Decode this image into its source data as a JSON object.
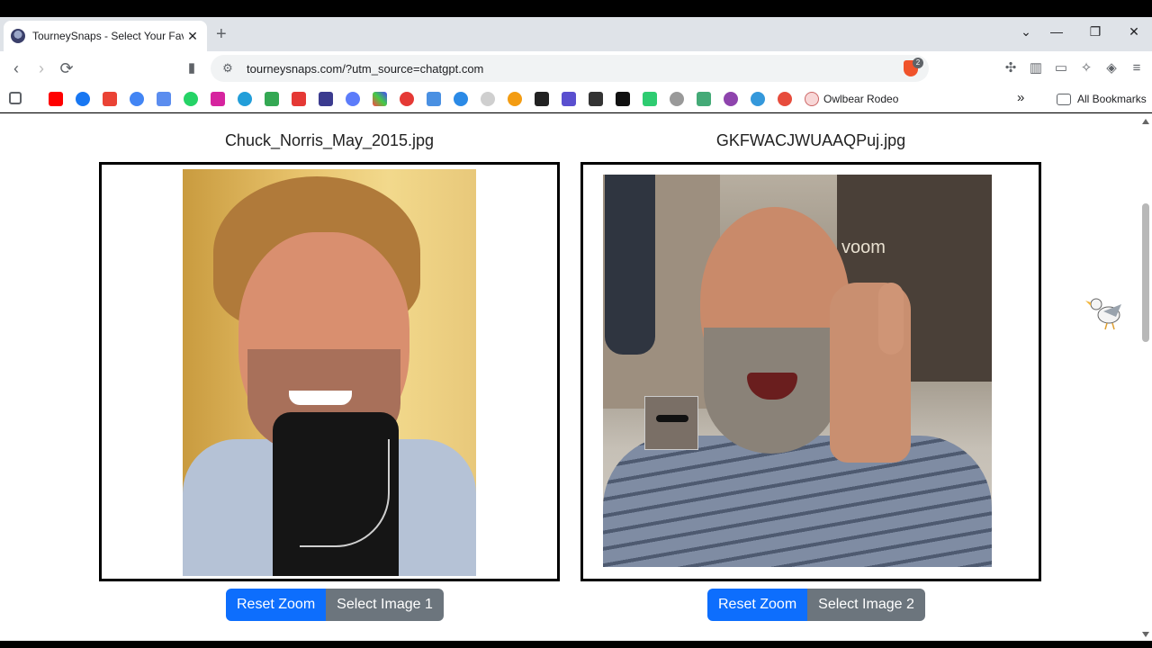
{
  "browser": {
    "tab_title": "TourneySnaps - Select Your Favo",
    "tab_close": "✕",
    "new_tab": "+",
    "url": "tourneysnaps.com/?utm_source=chatgpt.com",
    "brave_badge": "2",
    "window_controls": [
      "⌄",
      "—",
      "❐",
      "✕"
    ],
    "bookmarks_named": [
      "Owlbear Rodeo"
    ],
    "bookmarks_overflow": "»",
    "all_bookmarks": "All Bookmarks"
  },
  "left": {
    "filename": "Chuck_Norris_May_2015.jpg",
    "reset_label": "Reset Zoom",
    "select_label": "Select Image 1"
  },
  "right": {
    "filename": "GKFWACJWUAAQPuj.jpg",
    "reset_label": "Reset Zoom",
    "select_label": "Select Image 2",
    "sign_text": "voom"
  },
  "colors": {
    "primary_button": "#0d6efd",
    "secondary_button": "#6c757d"
  }
}
